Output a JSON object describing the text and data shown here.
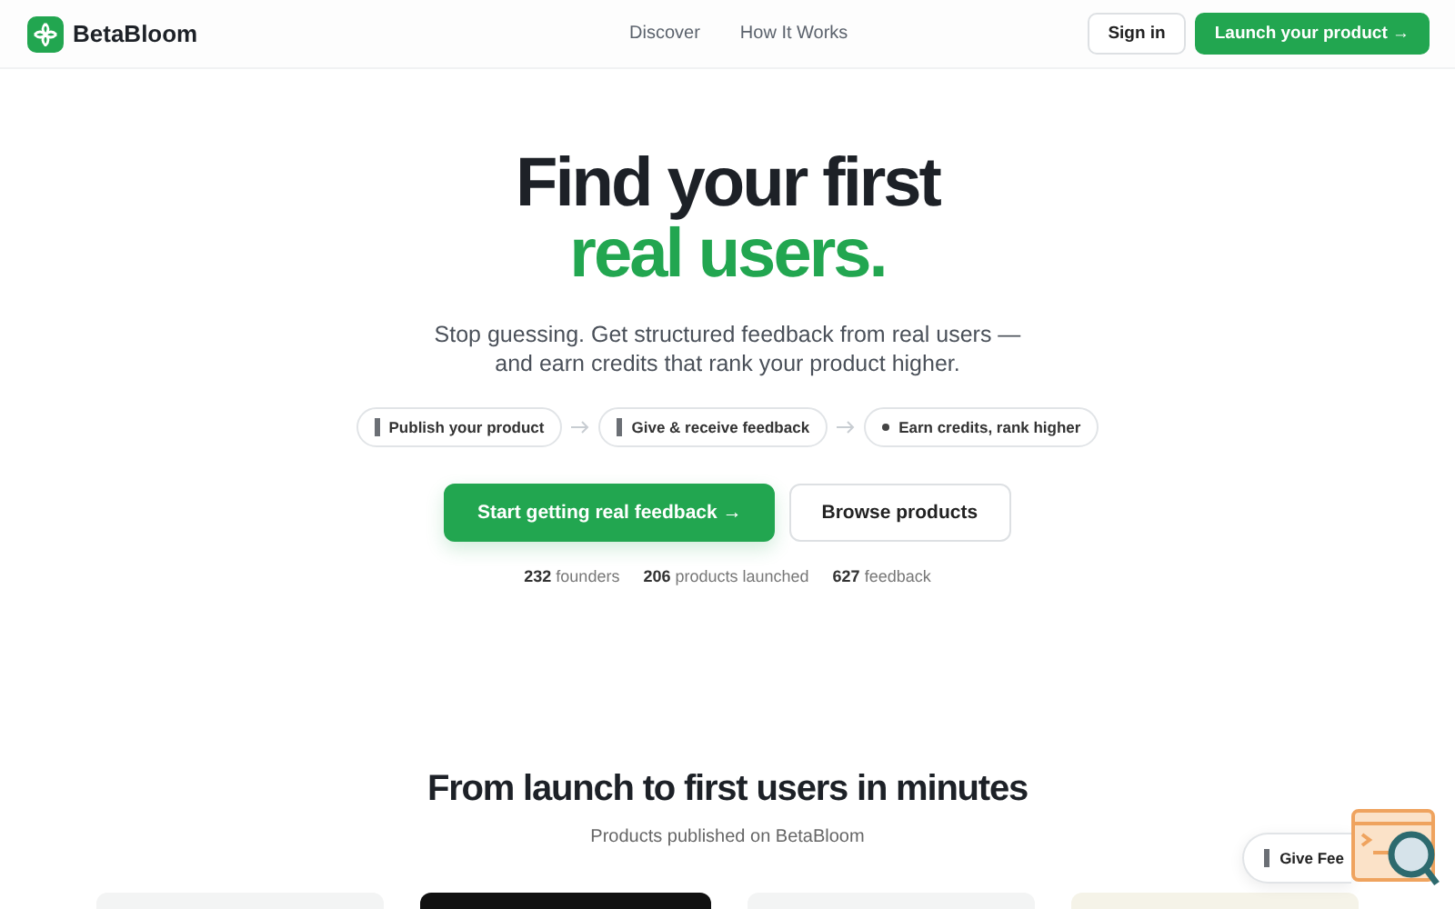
{
  "brand": "BetaBloom",
  "nav": [
    "Discover",
    "How It Works"
  ],
  "header_buttons": [
    {
      "label": "Sign in",
      "kind": "outline"
    },
    {
      "label": "Launch your product →",
      "kind": "primary"
    }
  ],
  "hero": {
    "title_line1": "Find your first",
    "title_line2": "real users.",
    "subtitle": "Stop guessing. Get structured feedback from real users — and earn credits that rank your product higher."
  },
  "steps": [
    {
      "label": "Publish your product",
      "kind": "bar"
    },
    {
      "label": "Give & receive feedback",
      "kind": "bar"
    },
    {
      "label": "Earn credits, rank higher",
      "kind": "dot"
    }
  ],
  "cta_buttons": [
    {
      "label": "Start getting real feedback →",
      "kind": "primary"
    },
    {
      "label": "Browse products",
      "kind": "outline"
    }
  ],
  "stats": [
    "**232** founders",
    "**206** products launched",
    "**627** feedback"
  ],
  "section": {
    "title": "From launch to first users in minutes",
    "subtitle": "Products published on BetaBloom"
  },
  "feedback_button": "Give Fee"
}
